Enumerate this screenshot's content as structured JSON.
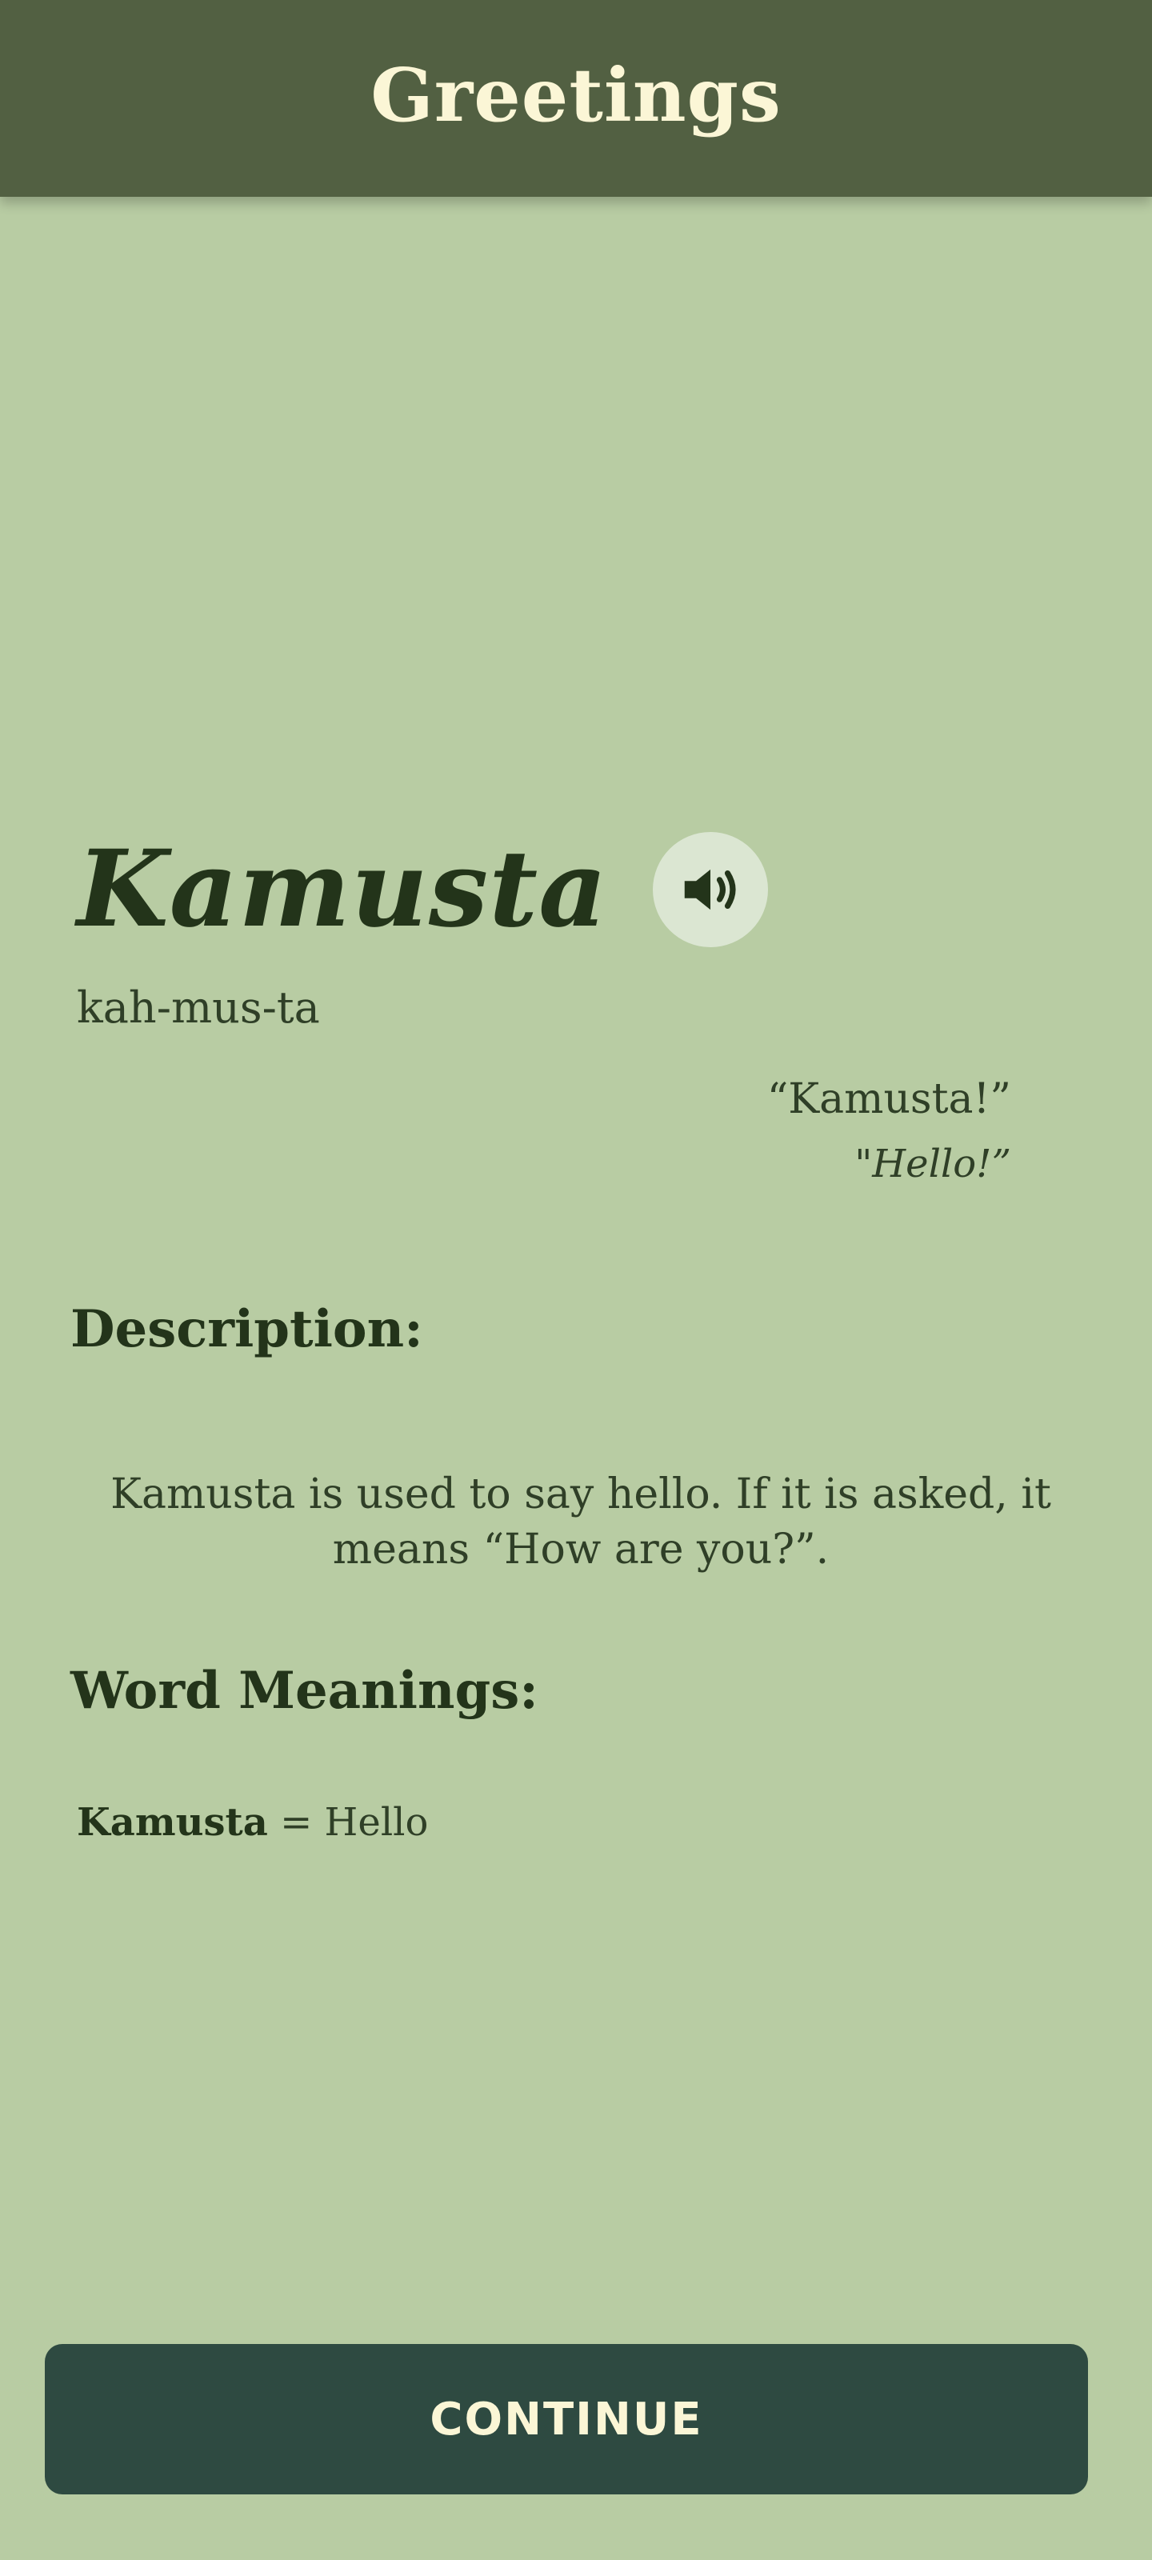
{
  "header": {
    "title": "Greetings"
  },
  "word": {
    "text": "Kamusta",
    "pronunciation": "kah-mus-ta",
    "audio_icon": "speaker-volume-icon"
  },
  "example": {
    "phrase": "“Kamusta!”",
    "translation": "\"Hello!”"
  },
  "description": {
    "heading": "Description:",
    "text": "Kamusta is used to say hello. If it is asked, it means “How are you?”."
  },
  "word_meanings": {
    "heading": "Word Meanings:",
    "items": [
      {
        "term": "Kamusta",
        "separator": " = ",
        "meaning": "Hello"
      }
    ]
  },
  "footer": {
    "continue_label": "CONTINUE"
  },
  "colors": {
    "background": "#b8cca3",
    "header": "#526042",
    "header_text": "#fbf6d6",
    "primary_text": "#23341a",
    "button": "#2e4a41",
    "audio_button": "#dbe6d2"
  }
}
